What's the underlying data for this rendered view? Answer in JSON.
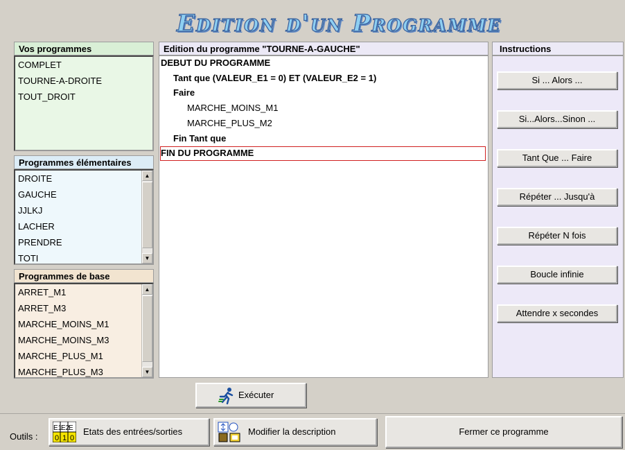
{
  "window": {
    "title": "Edition d'un Programme"
  },
  "vos_programmes": {
    "header": "Vos programmes",
    "items": [
      "COMPLET",
      "TOURNE-A-DROITE",
      "TOUT_DROIT"
    ]
  },
  "programmes_elementaires": {
    "header": "Programmes élémentaires",
    "items": [
      "DROITE",
      "GAUCHE",
      "JJLKJ",
      "LACHER",
      "PRENDRE",
      "TOTI"
    ]
  },
  "programmes_de_base": {
    "header": "Programmes de base",
    "items": [
      "ARRET_M1",
      "ARRET_M3",
      "MARCHE_MOINS_M1",
      "MARCHE_MOINS_M3",
      "MARCHE_PLUS_M1",
      "MARCHE_PLUS_M3"
    ]
  },
  "editor": {
    "header": "Edition du programme \"TOURNE-A-GAUCHE\"",
    "lines": [
      "DEBUT DU PROGRAMME",
      "Tant que (VALEUR_E1 = 0) ET (VALEUR_E2 = 1)",
      "Faire",
      "MARCHE_MOINS_M1",
      "MARCHE_PLUS_M2",
      "Fin Tant que",
      "FIN DU PROGRAMME"
    ]
  },
  "instructions": {
    "header": "Instructions",
    "buttons": [
      "Si ... Alors ...",
      "Si...Alors...Sinon ...",
      "Tant Que ... Faire",
      "Répéter ... Jusqu'à",
      "Répéter N fois",
      "Boucle infinie",
      "Attendre x secondes"
    ]
  },
  "actions": {
    "execute": "Exécuter",
    "tools_label": "Outils :",
    "io_states": "Etats des entrées/sorties",
    "io_icon_top": [
      "E1",
      "E2",
      "E"
    ],
    "io_icon_bottom": [
      "0",
      "1",
      "0"
    ],
    "modify_description": "Modifier la description",
    "close_program": "Fermer ce programme"
  },
  "colors": {
    "title_fill": "#8ecff2",
    "title_outline": "#3a5f9a",
    "selection_border": "#d02020",
    "io_icon_yellow": "#f5e400"
  }
}
